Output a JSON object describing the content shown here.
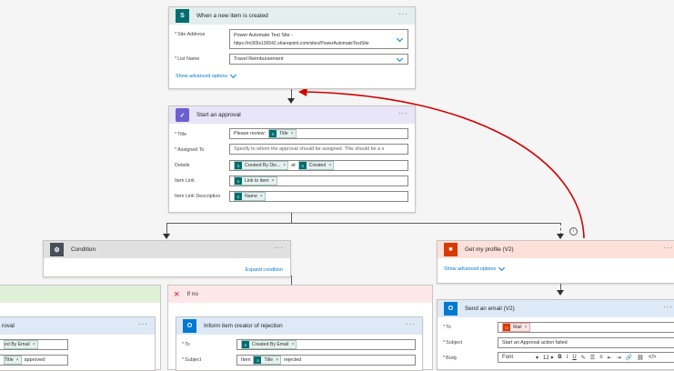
{
  "trigger": {
    "title": "When a new item is created",
    "icon": "sharepoint-icon",
    "site_address_label": "Site Address",
    "site_address_line1": "Power Automate Test Site -",
    "site_address_line2": "https://m365x136542.sharepoint.com/sites/PowerAutomateTestSite",
    "list_name_label": "List Name",
    "list_name_value": "Travel Reimbursement",
    "advanced_options": "Show advanced options",
    "more": "···"
  },
  "approval": {
    "title": "Start an approval",
    "icon": "approvals-icon",
    "title_label": "Title",
    "title_prefix": "Please review:",
    "title_token": "Title",
    "assigned_label": "Assigned To",
    "assigned_placeholder": "Specify to whom the approval should be assigned. This should be a s",
    "details_label": "Details",
    "details_token1": "Created By Dis...",
    "details_mid": "at",
    "details_token2": "Created",
    "item_link_label": "Item Link",
    "item_link_token": "Link to item",
    "item_link_desc_label": "Item Link Description",
    "item_link_desc_token": "Name",
    "more": "···"
  },
  "condition": {
    "title": "Condition",
    "icon": "condition-icon",
    "expand": "Expand condition",
    "more": "···"
  },
  "if_no": {
    "title": "If no",
    "icon": "close-icon"
  },
  "left_partial": {
    "title": "roval",
    "token1": "ed By Email",
    "token2": "Title",
    "suffix": "approved",
    "more": "···"
  },
  "inform": {
    "title": "Inform item creator of rejection",
    "icon": "outlook-icon",
    "to_label": "To",
    "to_token": "Created By Email",
    "subject_label": "Subject",
    "subject_prefix": "Item",
    "subject_token": "Title",
    "subject_suffix": "rejected",
    "more": "···"
  },
  "profile": {
    "title": "Get my profile (V2)",
    "icon": "office-icon",
    "advanced_options": "Show advanced options",
    "more": "···"
  },
  "email": {
    "title": "Send an email (V2)",
    "icon": "outlook-icon",
    "to_label": "To",
    "to_token": "Mail",
    "subject_label": "Subject",
    "subject_value": "Start an Approval action failed",
    "body_label": "Body",
    "font_value": "Font",
    "size_value": "12",
    "more": "···"
  },
  "colors": {
    "trigger_header": "#e3eeed",
    "approval_header": "#e8e5f8",
    "condition_header": "#e0e0e0",
    "profile_header": "#fde0da",
    "email_header": "#dde9f7",
    "if_no_header": "#fde7e9",
    "if_yes_header": "#dff0d8",
    "run_after_arrow": "#d40000"
  }
}
